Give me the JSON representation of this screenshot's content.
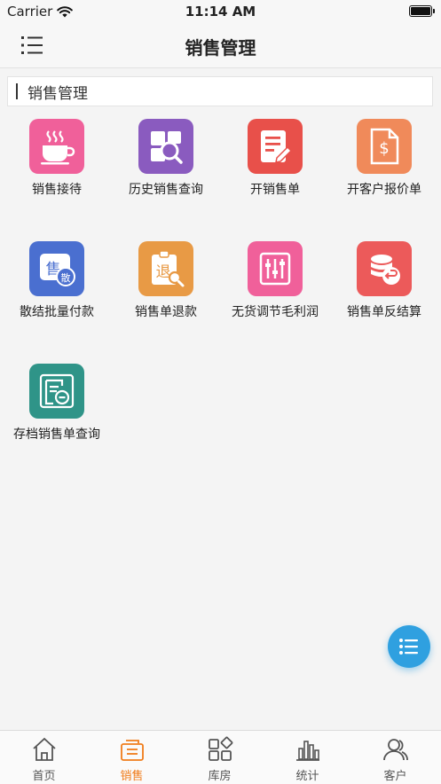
{
  "status_bar": {
    "carrier": "Carrier",
    "time": "11:14 AM"
  },
  "nav": {
    "title": "销售管理"
  },
  "section": {
    "title": "销售管理"
  },
  "items": [
    {
      "label": "销售接待",
      "color": "#f0609a",
      "icon": "coffee-cup-icon"
    },
    {
      "label": "历史销售查询",
      "color": "#8a5bbf",
      "icon": "search-document-icon"
    },
    {
      "label": "开销售单",
      "color": "#e8504a",
      "icon": "edit-document-icon"
    },
    {
      "label": "开客户报价单",
      "color": "#f08a5a",
      "icon": "price-document-icon"
    },
    {
      "label": "散结批量付款",
      "color": "#4a6fd0",
      "icon": "bulk-payment-icon"
    },
    {
      "label": "销售单退款",
      "color": "#e89a45",
      "icon": "refund-search-icon"
    },
    {
      "label": "无货调节毛利润",
      "color": "#f0609a",
      "icon": "adjust-sliders-icon"
    },
    {
      "label": "销售单反结算",
      "color": "#ec5a5a",
      "icon": "reverse-settle-icon"
    },
    {
      "label": "存档销售单查询",
      "color": "#2f9488",
      "icon": "archive-query-icon"
    }
  ],
  "icon_glyphs": {
    "sell": "售",
    "scatter": "散",
    "refund": "退",
    "dollar": "$"
  },
  "tabs": [
    {
      "label": "首页",
      "icon": "home-icon",
      "active": false
    },
    {
      "label": "销售",
      "icon": "sales-icon",
      "active": true
    },
    {
      "label": "库房",
      "icon": "warehouse-icon",
      "active": false
    },
    {
      "label": "统计",
      "icon": "statistics-icon",
      "active": false
    },
    {
      "label": "客户",
      "icon": "customers-icon",
      "active": false
    }
  ],
  "colors": {
    "accent": "#f07c1a",
    "fab": "#2fa0e0"
  }
}
